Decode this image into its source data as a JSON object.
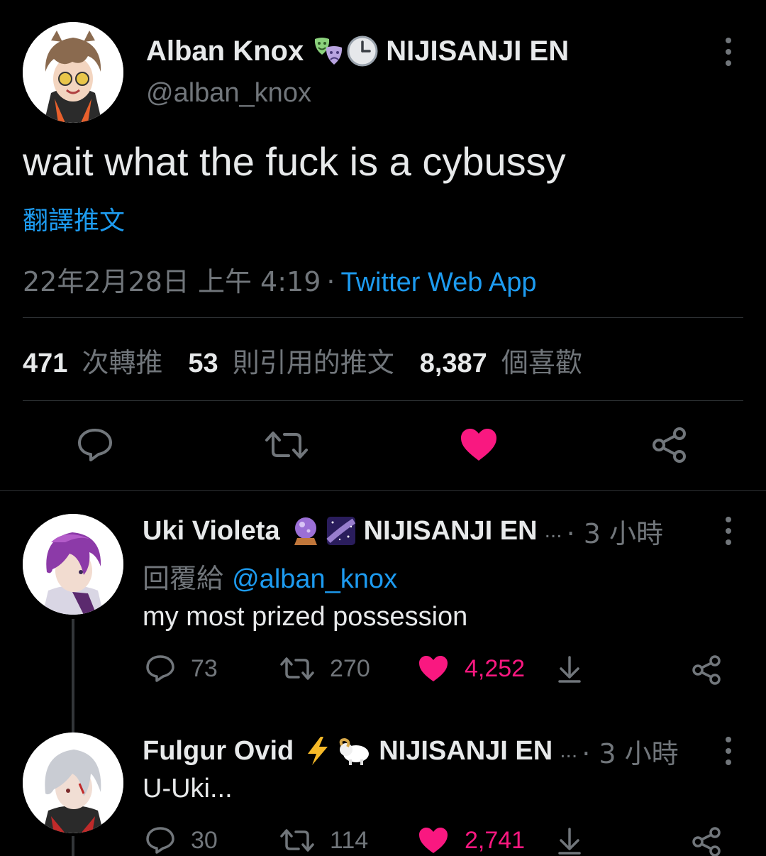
{
  "main_tweet": {
    "display_name": "Alban Knox",
    "emoji_1": "🎭",
    "emoji_2": "🕒",
    "affiliation": "NIJISANJI EN",
    "handle": "@alban_knox",
    "text": "wait what the fuck is a cybussy",
    "translate_label": "翻譯推文",
    "timestamp": "22年2月28日 上午 4:19",
    "separator": "·",
    "source": "Twitter Web App",
    "stats": {
      "retweets_count": "471",
      "retweets_label": "次轉推",
      "quotes_count": "53",
      "quotes_label": "則引用的推文",
      "likes_count": "8,387",
      "likes_label": "個喜歡"
    },
    "actions": {
      "reply_icon": "reply-icon",
      "retweet_icon": "retweet-icon",
      "like_icon": "heart-icon-filled",
      "share_icon": "share-icon"
    }
  },
  "replies": [
    {
      "display_name": "Uki Violeta",
      "emoji_1": "🔮",
      "emoji_2": "🌌",
      "affiliation": "NIJISANJI EN",
      "ellipsis": "...",
      "time": "· 3 小時",
      "reply_to_label": "回覆給",
      "reply_to_handle": "@alban_knox",
      "text": "my most prized possession",
      "reply_count": "73",
      "retweet_count": "270",
      "like_count": "4,252"
    },
    {
      "display_name": "Fulgur Ovid",
      "emoji_1": "⚡",
      "emoji_2": "🐏",
      "affiliation": "NIJISANJI EN",
      "ellipsis": "...",
      "time": "· 3 小時",
      "text": "U-Uki...",
      "reply_count": "30",
      "retweet_count": "114",
      "like_count": "2,741"
    }
  ],
  "colors": {
    "background": "#000000",
    "text_primary": "#e7e9ea",
    "text_secondary": "#71767b",
    "link": "#1d9bf0",
    "like": "#f91880",
    "divider": "#2f3336"
  }
}
